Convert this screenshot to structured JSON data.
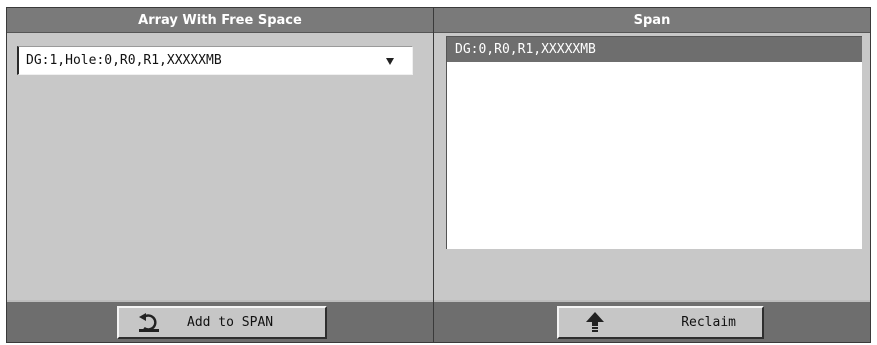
{
  "left_panel": {
    "title": "Array With Free Space",
    "dropdown": {
      "selected_value": "DG:1,Hole:0,R0,R1,XXXXXMB",
      "icon": "dropdown-arrow-icon"
    },
    "add_button": {
      "label": "Add to SPAN",
      "icon": "add-to-span-icon"
    }
  },
  "right_panel": {
    "title": "Span",
    "items": [
      {
        "label": "DG:0,R0,R1,XXXXXMB",
        "selected": true
      }
    ],
    "reclaim_button": {
      "label": "Reclaim",
      "icon": "up-arrow-icon"
    }
  },
  "colors": {
    "header": "#7a7a7a",
    "panel": "#c8c8c8",
    "footer": "#6e6e6e",
    "selection": "#6e6e6e"
  }
}
